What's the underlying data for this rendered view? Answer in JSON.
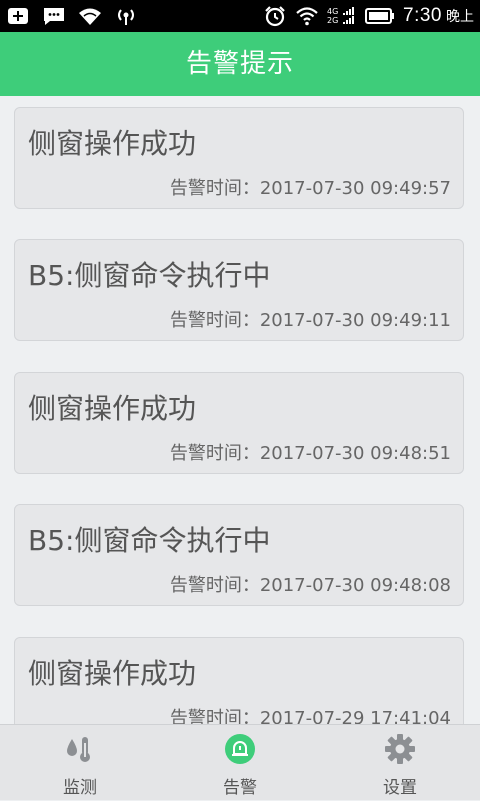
{
  "status_bar": {
    "network_top": "4G",
    "network_bottom": "2G",
    "time": "7:30",
    "ampm": "晚上"
  },
  "header": {
    "title": "告警提示"
  },
  "alarms": [
    {
      "title": "侧窗操作成功",
      "time": "告警时间：2017-07-30 09:49:57"
    },
    {
      "title": "B5:侧窗命令执行中",
      "time": "告警时间：2017-07-30 09:49:11"
    },
    {
      "title": "侧窗操作成功",
      "time": "告警时间：2017-07-30 09:48:51"
    },
    {
      "title": "B5:侧窗命令执行中",
      "time": "告警时间：2017-07-30 09:48:08"
    },
    {
      "title": "侧窗操作成功",
      "time": "告警时间：2017-07-29 17:41:04"
    }
  ],
  "nav": {
    "items": [
      {
        "label": "监测",
        "icon": "thermometer-drop-icon"
      },
      {
        "label": "告警",
        "icon": "alarm-bell-icon",
        "active": true
      },
      {
        "label": "设置",
        "icon": "gear-icon"
      }
    ]
  },
  "colors": {
    "accent": "#3ecd7a",
    "background": "#eef0f2",
    "card": "#e6e7e9"
  }
}
